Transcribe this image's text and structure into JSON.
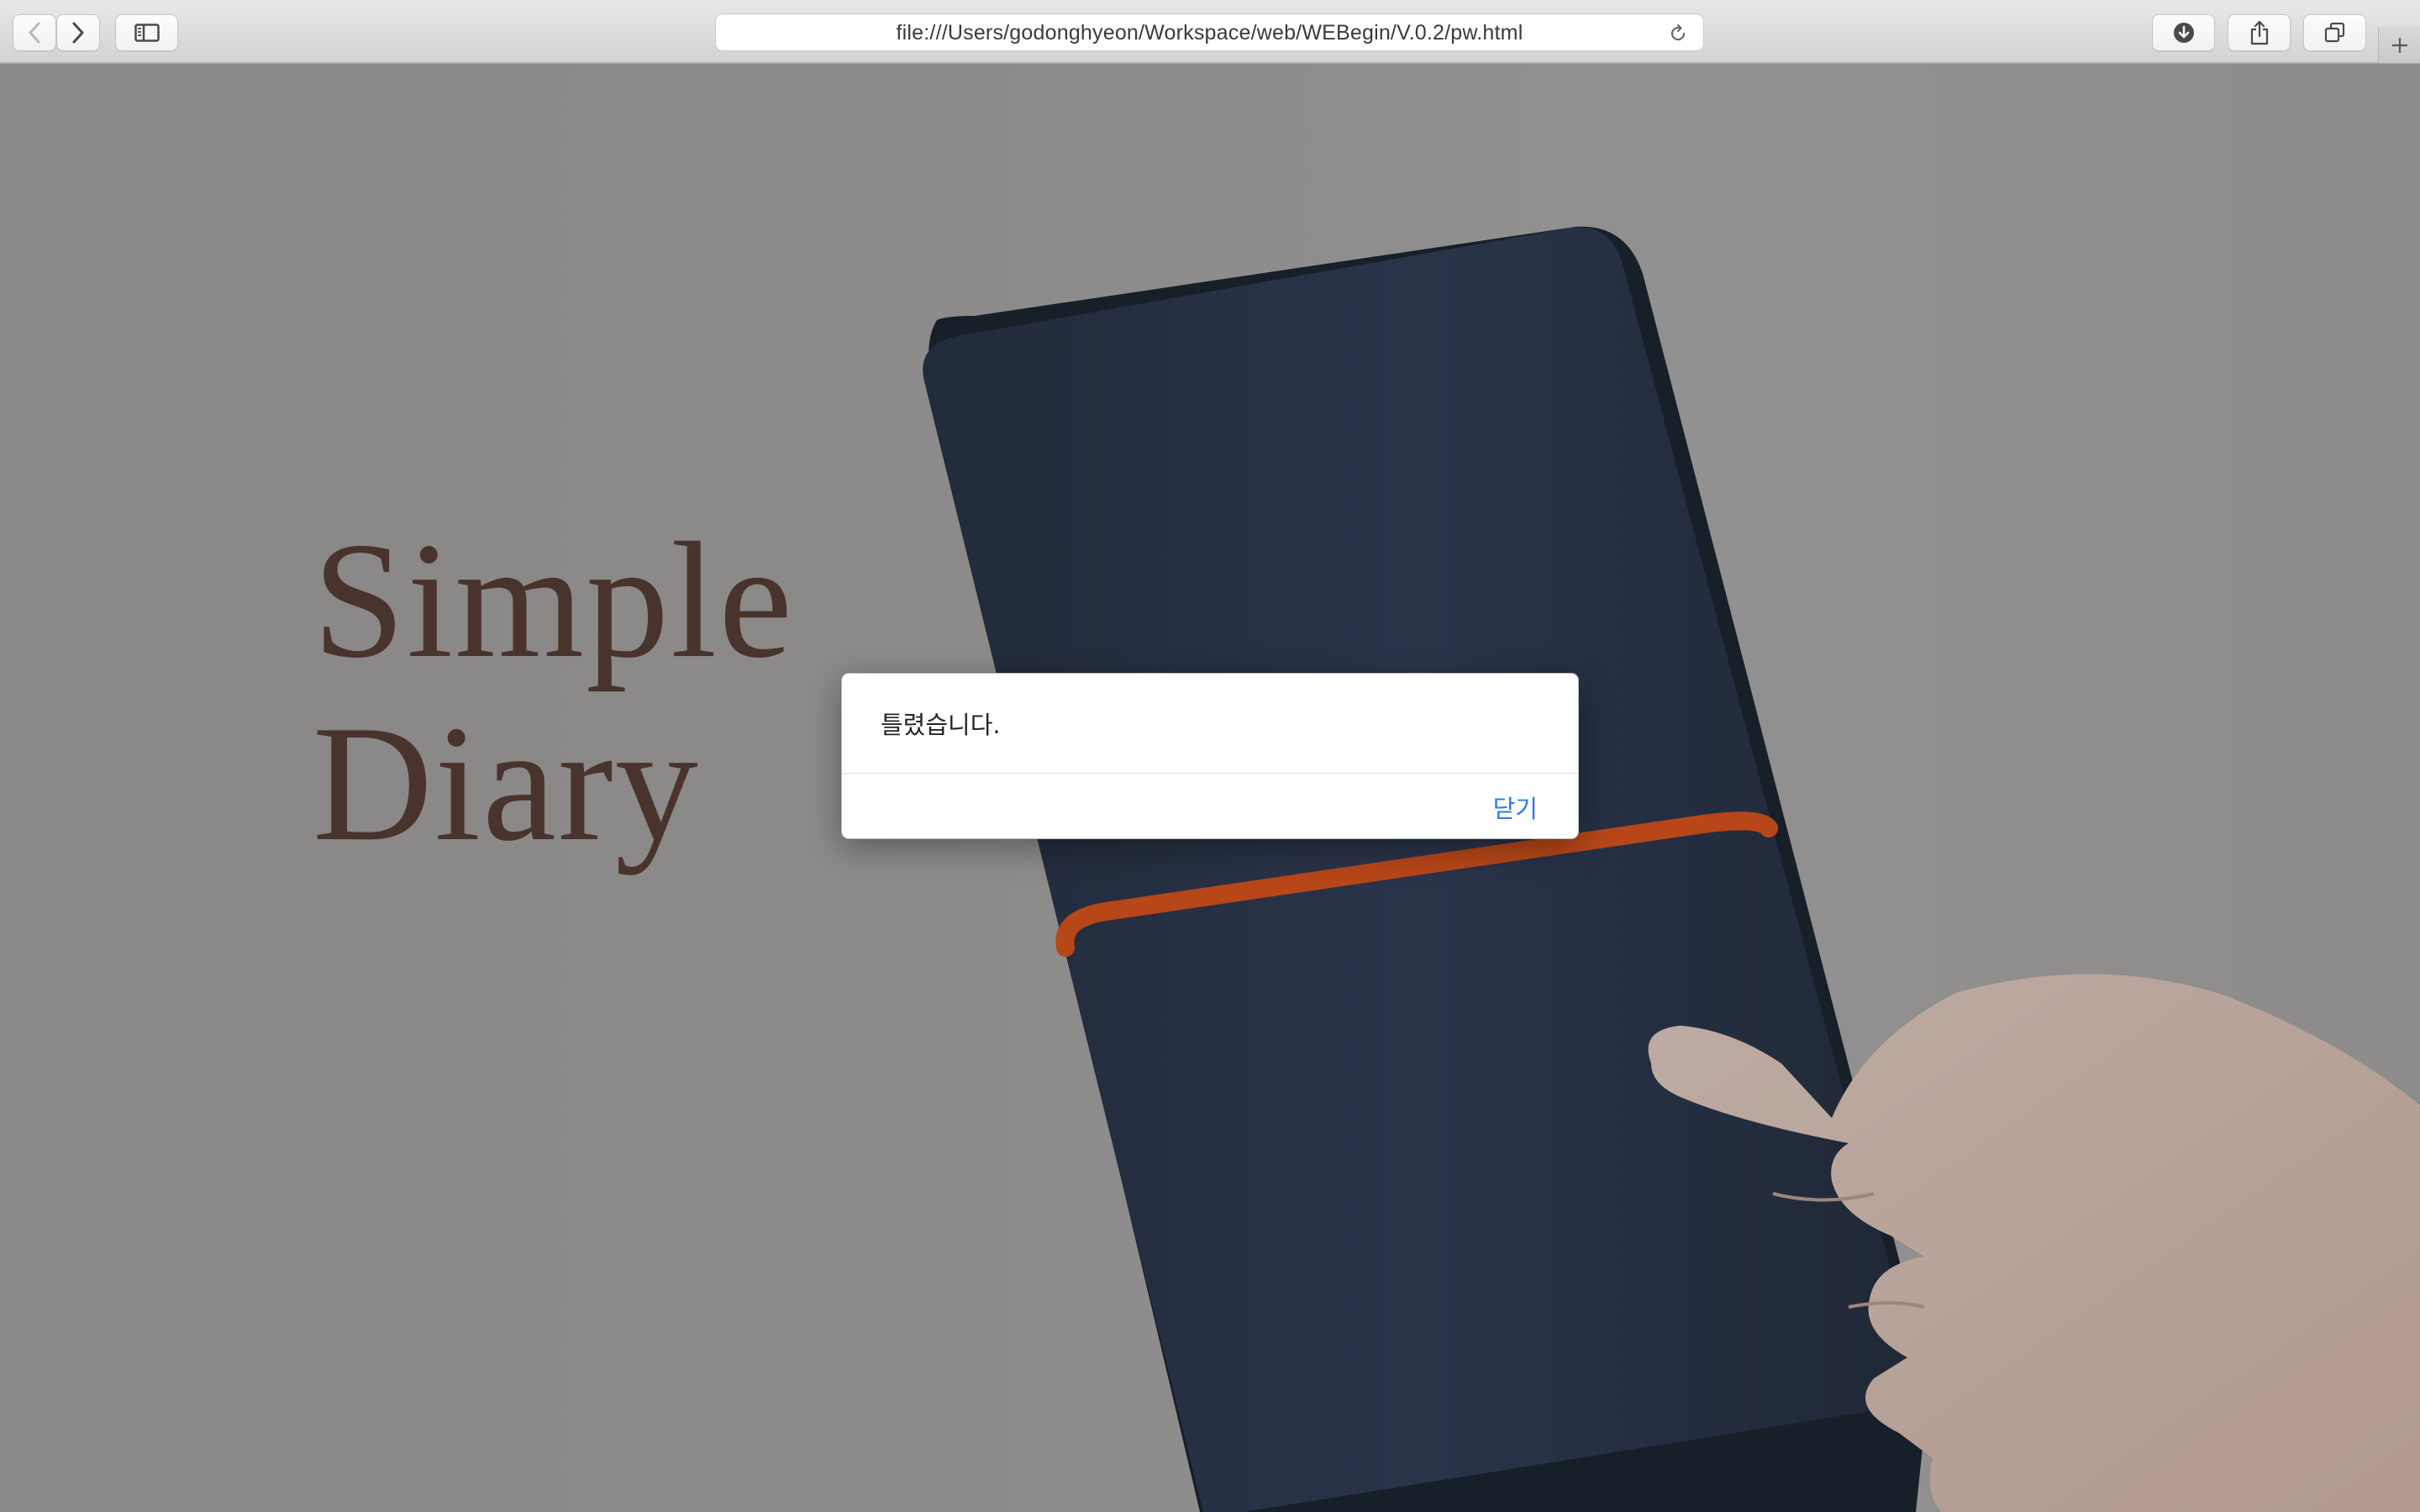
{
  "browser": {
    "url": "file:///Users/godonghyeon/Workspace/web/WEBegin/V.0.2/pw.html",
    "icons": {
      "back": "chevron-left-icon",
      "forward": "chevron-right-icon",
      "sidebar": "sidebar-icon",
      "reload": "reload-icon",
      "downloads": "download-icon",
      "share": "share-icon",
      "tabs": "tabs-icon",
      "new_tab": "plus-icon"
    }
  },
  "page": {
    "title_line1": "Simple",
    "title_line2": "Diary",
    "title_color": "#5a4038",
    "notebook_color": "#2e3a4d",
    "band_color": "#e0561e"
  },
  "dialog": {
    "message": "틀렸습니다.",
    "close_label": "닫기",
    "accent": "#2b7ce9"
  }
}
